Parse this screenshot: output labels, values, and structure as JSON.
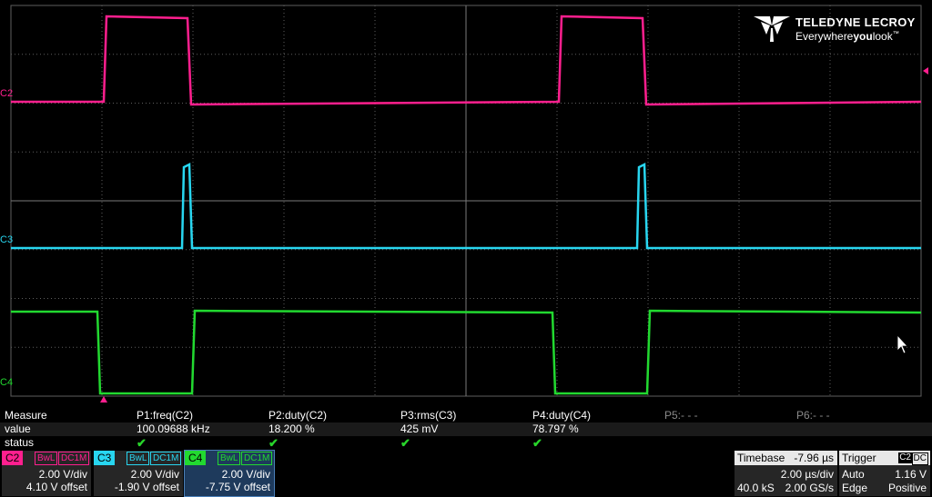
{
  "colors": {
    "c2": "#ff1f8e",
    "c3": "#28d6f0",
    "c4": "#22d930",
    "grid": "#5e5e5e",
    "background": "#000000"
  },
  "traces": {
    "c2_label": "C2",
    "c3_label": "C3",
    "c4_label": "C4"
  },
  "logo": {
    "brand": "TELEDYNE LECROY",
    "tag_a": "Everywhere",
    "tag_b": "you",
    "tag_c": "look",
    "tm": "™"
  },
  "measure": {
    "row_labels": [
      "Measure",
      "value",
      "status"
    ],
    "params": [
      {
        "name": "P1:freq(C2)",
        "value": "100.09688 kHz",
        "status": "✔"
      },
      {
        "name": "P2:duty(C2)",
        "value": "18.200 %",
        "status": "✔"
      },
      {
        "name": "P3:rms(C3)",
        "value": "425 mV",
        "status": "✔"
      },
      {
        "name": "P4:duty(C4)",
        "value": "78.797 %",
        "status": "✔"
      },
      {
        "name": "P5:- - -",
        "value": "",
        "status": ""
      },
      {
        "name": "P6:- - -",
        "value": "",
        "status": ""
      }
    ]
  },
  "channels": [
    {
      "name": "C2",
      "bw": "BwL",
      "coupling": "DC1M",
      "vdiv": "2.00 V/div",
      "offset": "4.10 V offset",
      "color": "#ff1f8e"
    },
    {
      "name": "C3",
      "bw": "BwL",
      "coupling": "DC1M",
      "vdiv": "2.00 V/div",
      "offset": "-1.90 V offset",
      "color": "#28d6f0"
    },
    {
      "name": "C4",
      "bw": "BwL",
      "coupling": "DC1M",
      "vdiv": "2.00 V/div",
      "offset": "-7.75 V offset",
      "color": "#22d930"
    }
  ],
  "timebase": {
    "title": "Timebase",
    "delay": "-7.96 µs",
    "tdiv": "2.00 µs/div",
    "samples": "40.0 kS",
    "rate": "2.00 GS/s"
  },
  "trigger": {
    "title": "Trigger",
    "source": "C2",
    "coupling": "DC",
    "mode": "Auto",
    "level": "1.16 V",
    "type": "Edge",
    "slope": "Positive"
  }
}
